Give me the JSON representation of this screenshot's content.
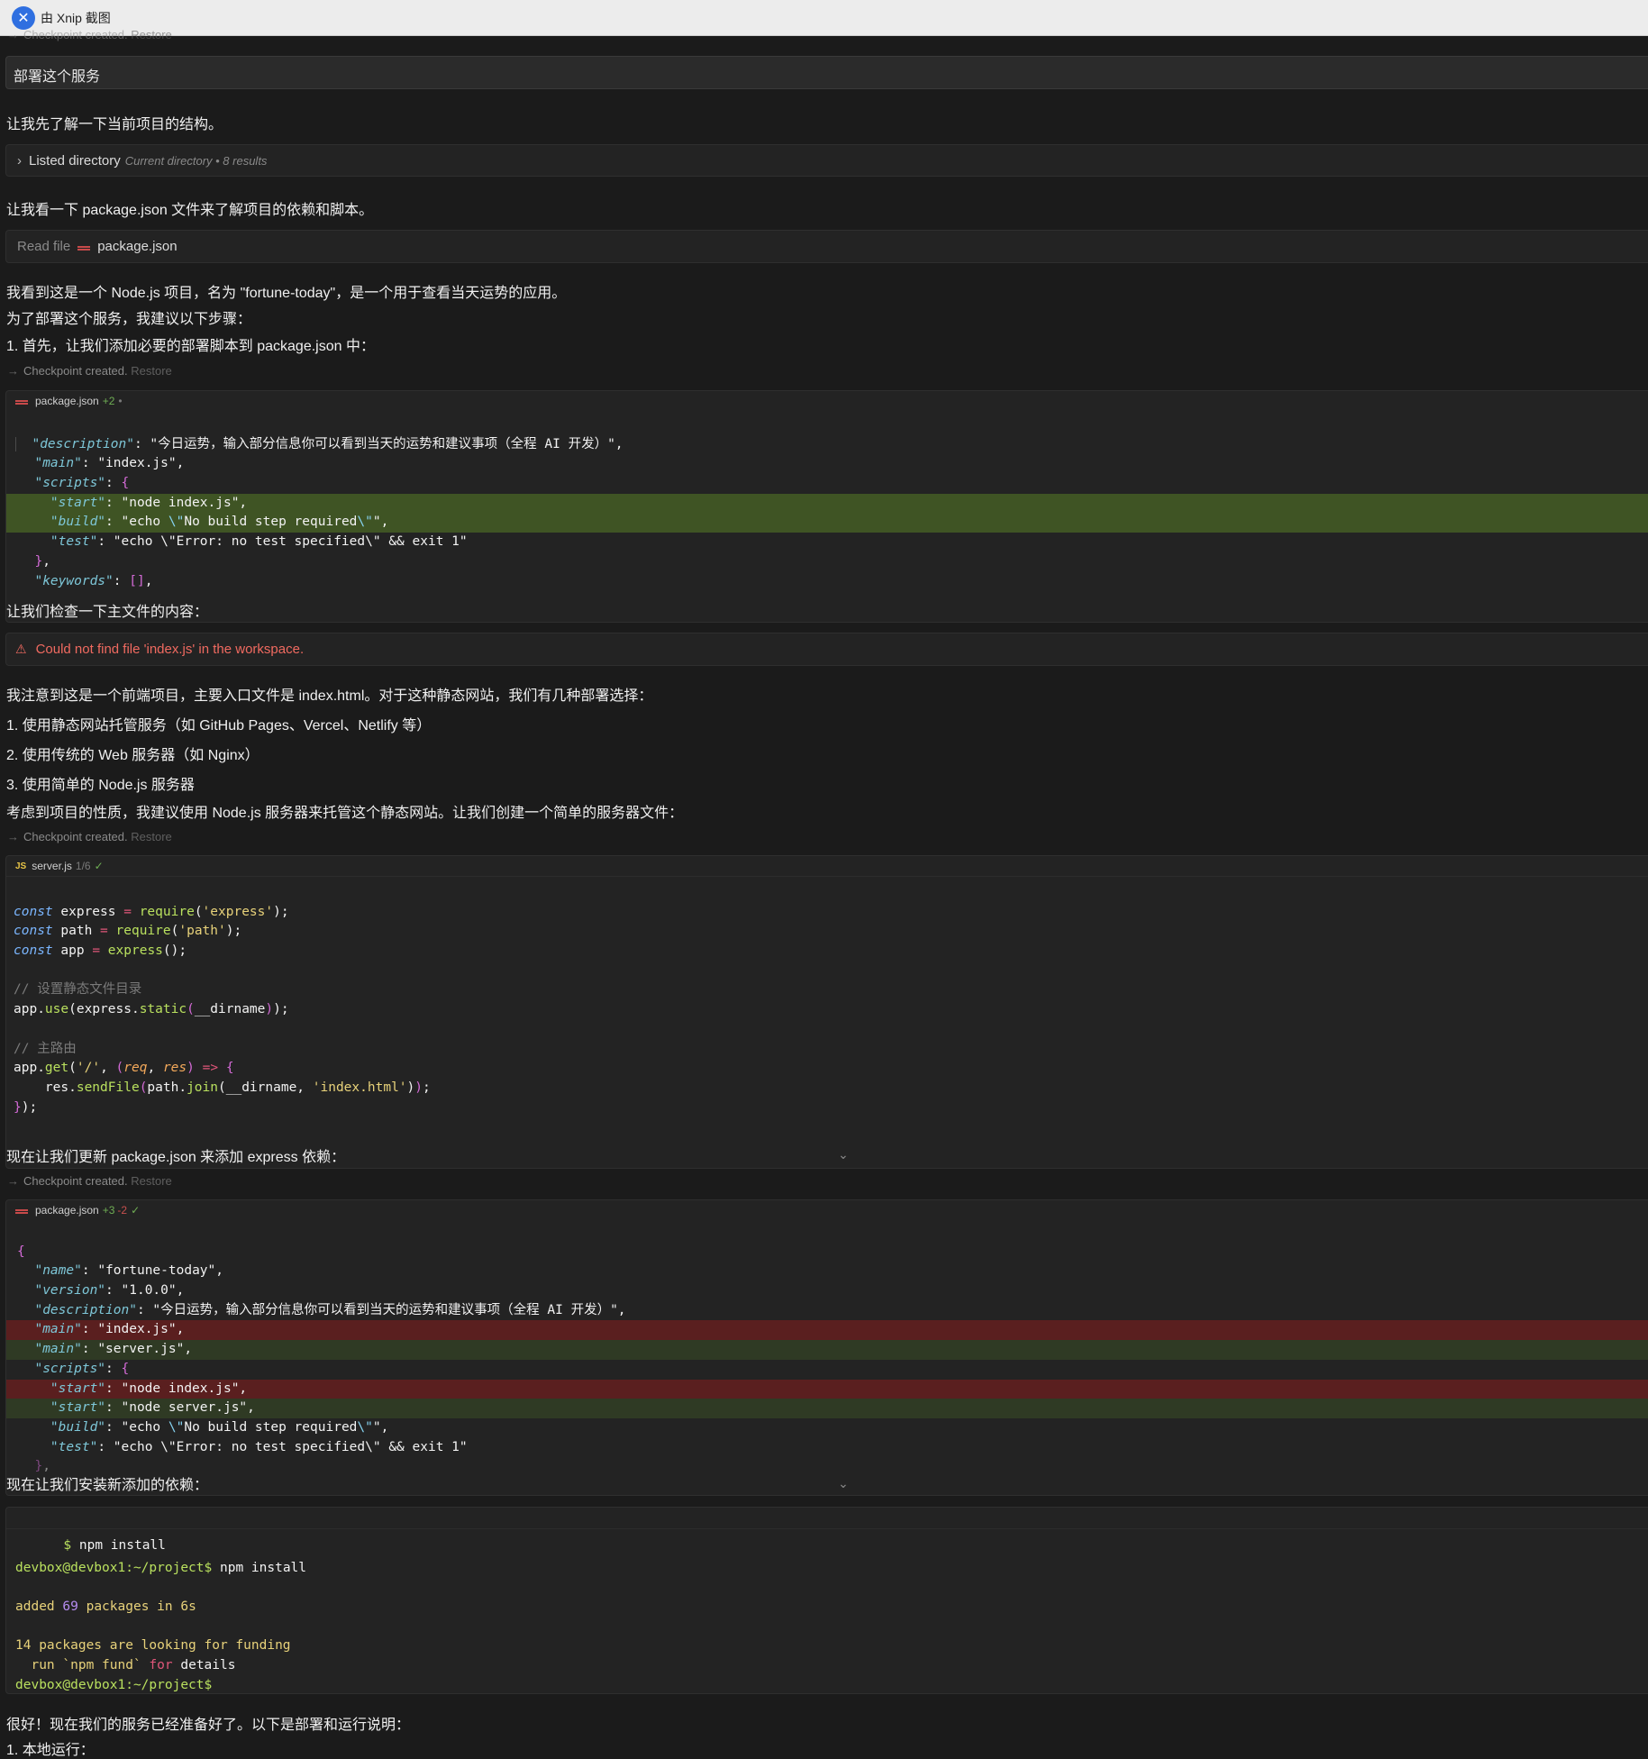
{
  "window": {
    "title": "由 Xnip 截图"
  },
  "checkpoint": {
    "text": "Checkpoint created.",
    "restore": "Restore"
  },
  "user_message": "部署这个服务",
  "messages": {
    "m1": "让我先了解一下当前项目的结构。",
    "m2": "让我看一下 package.json 文件来了解项目的依赖和脚本。",
    "m3": "我看到这是一个 Node.js 项目，名为 \"fortune-today\"，是一个用于查看当天运势的应用。",
    "m4": "为了部署这个服务，我建议以下步骤：",
    "m5": "1. 首先，让我们添加必要的部署脚本到 package.json 中：",
    "m6": "让我们检查一下主文件的内容：",
    "m7": "我注意到这是一个前端项目，主要入口文件是 index.html。对于这种静态网站，我们有几种部署选择：",
    "m8": "1. 使用静态网站托管服务（如 GitHub Pages、Vercel、Netlify 等）",
    "m9": "2. 使用传统的 Web 服务器（如 Nginx）",
    "m10": "3. 使用简单的 Node.js 服务器",
    "m11": "考虑到项目的性质，我建议使用 Node.js 服务器来托管这个静态网站。让我们创建一个简单的服务器文件：",
    "m12": "现在让我们更新 package.json 来添加 express 依赖：",
    "m13": "现在让我们安装新添加的依赖：",
    "m14": "很好！现在我们的服务已经准备好了。以下是部署和运行说明：",
    "m15": "1. 本地运行："
  },
  "listed_dir": {
    "label": "Listed directory",
    "detail": "Current directory • 8 results"
  },
  "read_file": {
    "label": "Read file",
    "file": "package.json"
  },
  "edit1": {
    "file": "package.json",
    "added": "+2",
    "status": "•"
  },
  "error": {
    "icon": "warning-icon",
    "text": "Could not find file 'index.js' in the workspace."
  },
  "edit_server": {
    "file": "server.js",
    "meta": "1/6",
    "status": "✓"
  },
  "edit2": {
    "file": "package.json",
    "added": "+3",
    "removed": "-2",
    "status": "✓"
  },
  "terminal": {
    "command": "npm install",
    "prompt": "devbox@devbox1:~/project$",
    "added_line": "added 69 packages in 6s",
    "funding_line": "14 packages are looking for funding",
    "fund_hint": "run `npm fund` for details"
  }
}
